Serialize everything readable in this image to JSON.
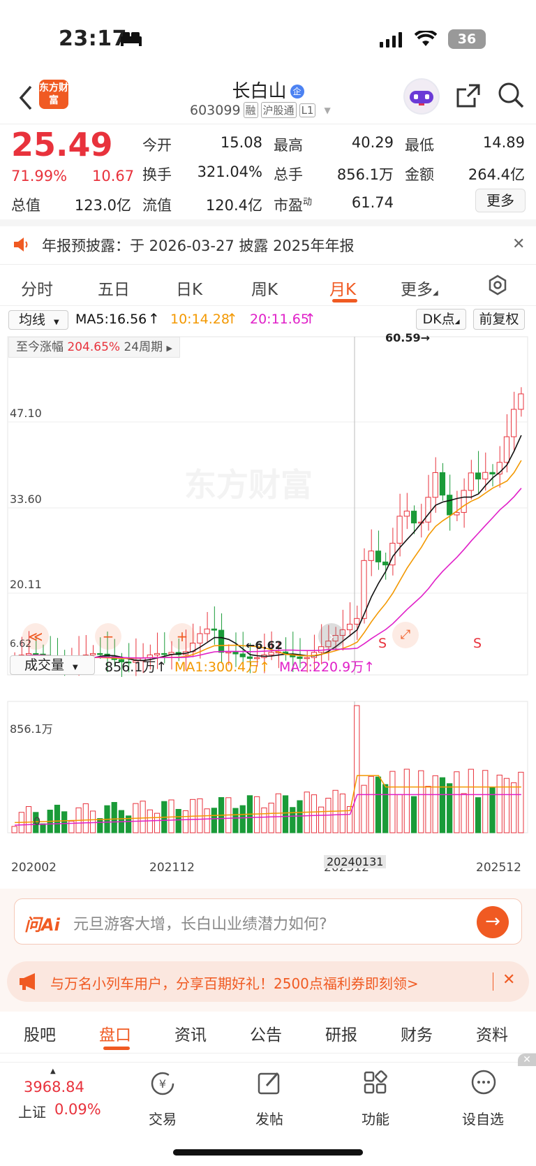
{
  "status": {
    "time": "23:17",
    "battery": "36"
  },
  "header": {
    "stock_name": "长白山",
    "stock_code": "603099",
    "tags": [
      "融",
      "沪股通",
      "L1"
    ],
    "logo_text": "东方财富",
    "qi_badge": "企"
  },
  "quote": {
    "price": "25.49",
    "change_pct": "71.99%",
    "change_amt": "10.67",
    "open_label": "今开",
    "open": "15.08",
    "high_label": "最高",
    "high": "40.29",
    "low_label": "最低",
    "low": "14.89",
    "turnover_label": "换手",
    "turnover": "321.04%",
    "volume_label": "总手",
    "volume": "856.1万",
    "amount_label": "金额",
    "amount": "264.4亿",
    "mcap_label": "总值",
    "mcap": "123.0亿",
    "float_label": "流值",
    "float": "120.4亿",
    "pe_label": "市盈",
    "pe_sup": "动",
    "pe": "61.74",
    "more": "更多"
  },
  "notice": {
    "text": "年报预披露：于 2026-03-27 披露 2025年年报"
  },
  "tabs": [
    "分时",
    "五日",
    "日K",
    "周K",
    "月K",
    "更多"
  ],
  "active_tab": "月K",
  "chart": {
    "ma_selector": "均线",
    "ma5": "MA5:16.56",
    "ma10": "10:14.28",
    "ma20": "20:11.65",
    "dk": "DK点",
    "fq": "前复权",
    "gain_label": "至今涨幅",
    "gain": "204.65%",
    "period": "24周期",
    "yticks": [
      "47.10",
      "33.60",
      "20.11"
    ],
    "ytick_bottom": "6.62",
    "high_mark": "60.59",
    "low_mark": "6.62",
    "watermark": "东方财富",
    "vol_selector": "成交量",
    "vol_val": "856.1万",
    "vol_ma1": "MA1:300.4万",
    "vol_ma2": "MA2:220.9万",
    "vol_top": "856.1万",
    "vol_zero": "0",
    "xticks": [
      "202002",
      "202112",
      "202312",
      "202512"
    ],
    "cursor_date": "20240131",
    "s_mark": "S"
  },
  "ai": {
    "label": "问Ai",
    "placeholder": "元旦游客大增，长白山业绩潜力如何?"
  },
  "promo": {
    "text": "与万名小列车用户，分享百期好礼！2500点福利券即刻领>"
  },
  "subtabs": [
    "股吧",
    "盘口",
    "资讯",
    "公告",
    "研报",
    "财务",
    "资料"
  ],
  "active_subtab": "盘口",
  "index": {
    "value": "3968.84",
    "name": "上证",
    "pct": "0.09%"
  },
  "nav": [
    "交易",
    "发帖",
    "功能",
    "设自选"
  ]
}
